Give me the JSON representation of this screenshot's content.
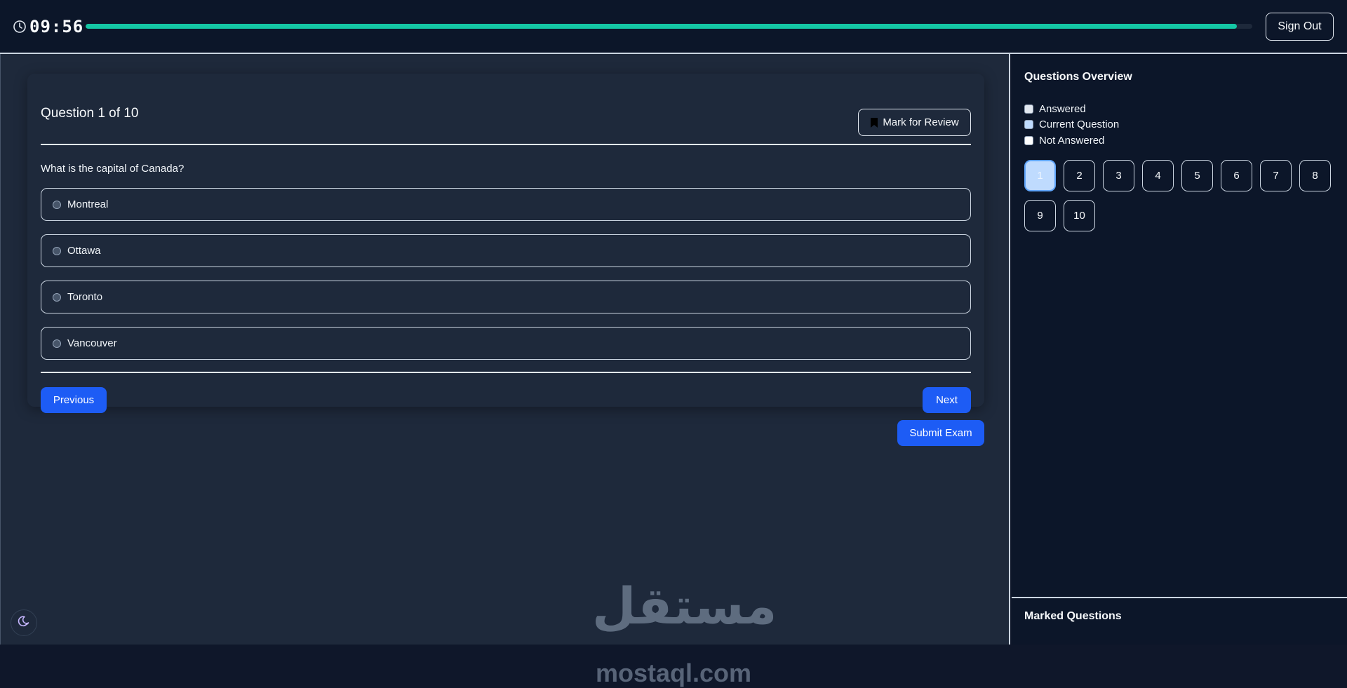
{
  "header": {
    "timer": "09:56",
    "progress_fraction": 0.987,
    "progress_color": "#14c7a5",
    "signout_label": "Sign Out",
    "clock_icon": "clock-icon"
  },
  "question": {
    "title": "Question 1 of 10",
    "mark_label": "Mark for Review",
    "bookmark_icon": "bookmark-icon",
    "text": "What is the capital of Canada?",
    "options": [
      {
        "label": "Montreal"
      },
      {
        "label": "Ottawa"
      },
      {
        "label": "Toronto"
      },
      {
        "label": "Vancouver"
      }
    ],
    "previous_label": "Previous",
    "next_label": "Next"
  },
  "submit_label": "Submit Exam",
  "accent_color": "#1d5cf5",
  "watermark": {
    "arabic": "مستقل",
    "latin": "mostaql.com"
  },
  "theme_icon": "moon-icon",
  "sidebar": {
    "title": "Questions Overview",
    "legend": [
      {
        "label": "Answered",
        "color": "#e2e8f0"
      },
      {
        "label": "Current Question",
        "color": "#bfdbfe"
      },
      {
        "label": "Not Answered",
        "color": "#ffffff"
      }
    ],
    "numbers": [
      "1",
      "2",
      "3",
      "4",
      "5",
      "6",
      "7",
      "8",
      "9",
      "10"
    ],
    "current_index": 0,
    "marked_title": "Marked Questions"
  }
}
